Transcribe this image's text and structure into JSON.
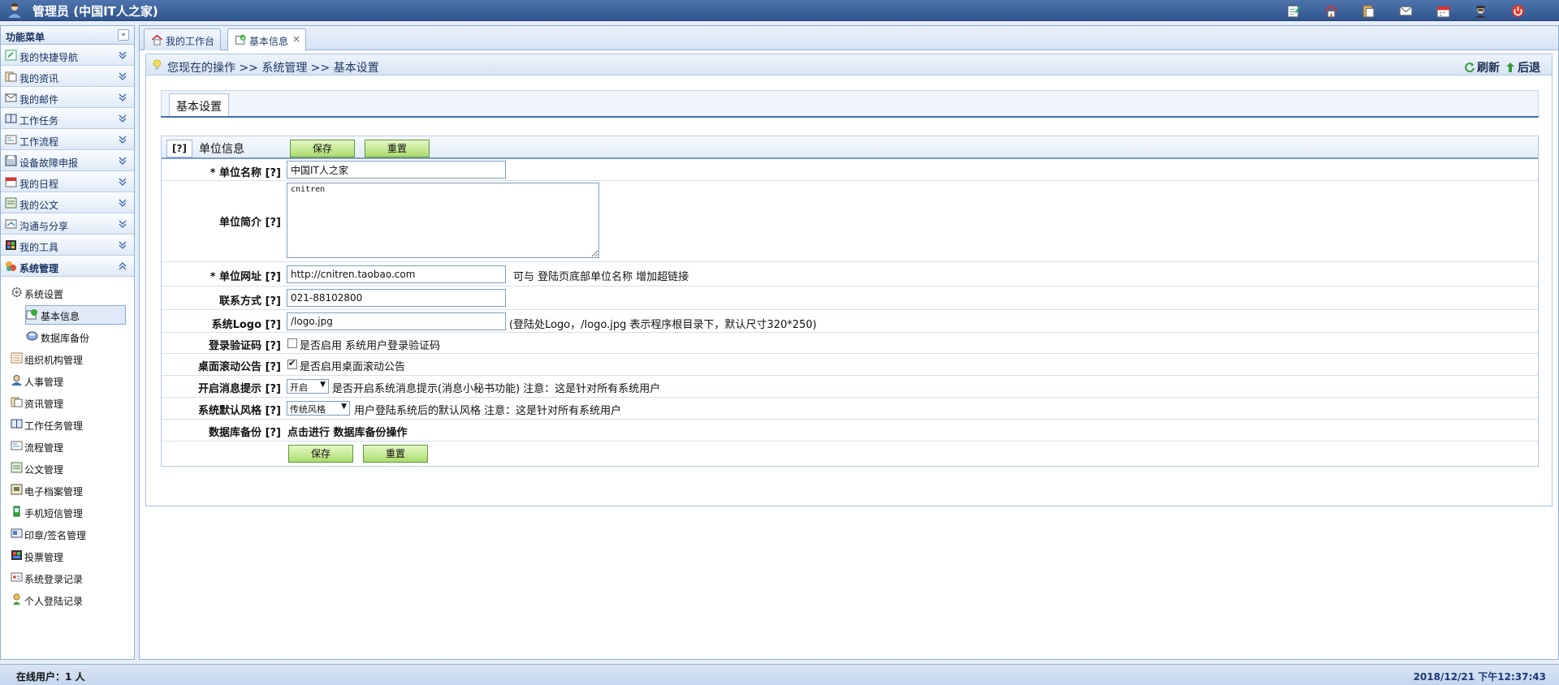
{
  "app": {
    "title": "管理员 (中国IT人之家)",
    "toolbar_icons": [
      "note-edit-icon",
      "home-icon",
      "clipboard-icon",
      "mail-icon",
      "calendar-icon",
      "user-spy-icon",
      "power-icon"
    ]
  },
  "sidebar": {
    "title": "功能菜单",
    "menu": [
      {
        "label": "我的快捷导航",
        "icon": "shortcut-icon"
      },
      {
        "label": "我的资讯",
        "icon": "news-icon"
      },
      {
        "label": "我的邮件",
        "icon": "mail-icon"
      },
      {
        "label": "工作任务",
        "icon": "book-icon"
      },
      {
        "label": "工作流程",
        "icon": "flow-icon"
      },
      {
        "label": "设备故障申报",
        "icon": "disk-icon"
      },
      {
        "label": "我的日程",
        "icon": "calendar-icon"
      },
      {
        "label": "我的公文",
        "icon": "document-icon"
      },
      {
        "label": "沟通与分享",
        "icon": "share-icon"
      },
      {
        "label": "我的工具",
        "icon": "tools-icon"
      },
      {
        "label": "系统管理",
        "icon": "system-icon"
      }
    ],
    "tree": [
      {
        "label": "系统设置",
        "icon": "gear-icon"
      },
      {
        "label": "基本信息",
        "icon": "info-icon"
      },
      {
        "label": "数据库备份",
        "icon": "database-icon"
      },
      {
        "label": "组织机构管理",
        "icon": "org-icon"
      },
      {
        "label": "人事管理",
        "icon": "person-icon"
      },
      {
        "label": "资讯管理",
        "icon": "news-icon"
      },
      {
        "label": "工作任务管理",
        "icon": "book-icon"
      },
      {
        "label": "流程管理",
        "icon": "flow-icon"
      },
      {
        "label": "公文管理",
        "icon": "document-icon"
      },
      {
        "label": "电子档案管理",
        "icon": "archive-icon"
      },
      {
        "label": "手机短信管理",
        "icon": "phone-icon"
      },
      {
        "label": "印章/签名管理",
        "icon": "seal-icon"
      },
      {
        "label": "投票管理",
        "icon": "vote-icon"
      },
      {
        "label": "系统登录记录",
        "icon": "login-log-icon"
      },
      {
        "label": "个人登陆记录",
        "icon": "person-log-icon"
      }
    ]
  },
  "tabs": [
    {
      "label": "我的工作台",
      "icon": "home-icon"
    },
    {
      "label": "基本信息",
      "icon": "info-icon",
      "close": "×"
    }
  ],
  "breadcrumb": {
    "text": "您现在的操作 >> 系统管理 >> 基本设置",
    "refresh": "刷新",
    "back": "后退"
  },
  "section": {
    "title": "基本设置"
  },
  "form": {
    "help": "[?]",
    "title": "单位信息",
    "save": "保存",
    "reset": "重置",
    "fields": {
      "name_label": "* 单位名称 [?]",
      "name_value": "中国IT人之家",
      "intro_label": "单位简介 [?]",
      "intro_value": "cnitren",
      "url_label": "* 单位网址 [?]",
      "url_value": "http://cnitren.taobao.com",
      "url_hint": "可与 登陆页底部单位名称 增加超链接",
      "contact_label": "联系方式 [?]",
      "contact_value": "021-88102800",
      "logo_label": "系统Logo [?]",
      "logo_value": "/logo.jpg",
      "logo_hint": "(登陆处Logo，/logo.jpg 表示程序根目录下，默认尺寸320*250)",
      "captcha_label": "登录验证码 [?]",
      "captcha_hint": "是否启用 系统用户登录验证码",
      "captcha_checked": false,
      "marquee_label": "桌面滚动公告 [?]",
      "marquee_hint": "是否启用桌面滚动公告",
      "marquee_checked": true,
      "msg_label": "开启消息提示 [?]",
      "msg_value": "开启",
      "msg_hint": "是否开启系统消息提示(消息小秘书功能) 注意：这是针对所有系统用户",
      "style_label": "系统默认风格 [?]",
      "style_value": "传统风格",
      "style_hint": "用户登陆系统后的默认风格  注意：这是针对所有系统用户",
      "backup_label": "数据库备份 [?]",
      "backup_text": "点击进行 数据库备份操作"
    }
  },
  "status": {
    "online": "在线用户：1 人",
    "datetime": "2018/12/21 下午12:37:43"
  },
  "colors": {
    "accent": "#2f5590",
    "button_green": "#a9dc6b",
    "border_blue": "#8fb0d8"
  }
}
